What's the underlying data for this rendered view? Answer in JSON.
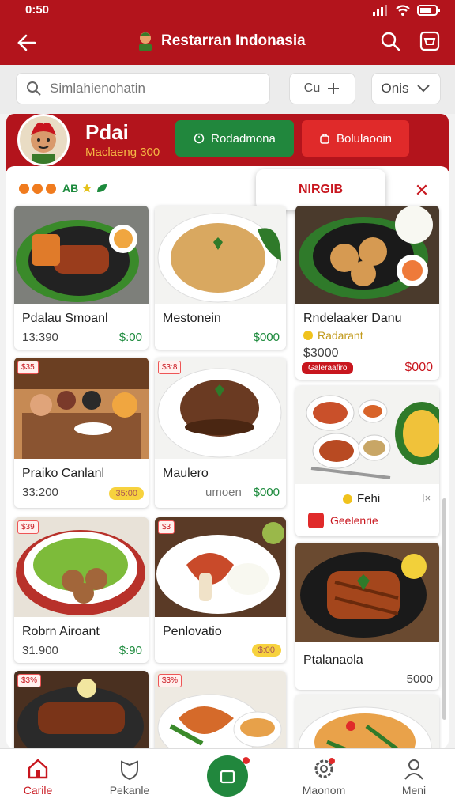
{
  "status": {
    "time": "0:50"
  },
  "appbar": {
    "title": "Restarran Indonasia"
  },
  "search": {
    "placeholder": "Simlahienohatin",
    "filter_label": "Cu",
    "sort_label": "Onis"
  },
  "profile": {
    "name": "Pdai",
    "subtitle": "Maclaeng 300",
    "btn_green": "Rodadmona",
    "btn_red": "Bolulaooin"
  },
  "panel": {
    "badge": "AB",
    "popup": "NIRGIB"
  },
  "cards": [
    {
      "name": "Pdalau Smoanl",
      "price": "13:390",
      "price2": "$:00"
    },
    {
      "name": "Mestonein",
      "price": "",
      "price2": "$000"
    },
    {
      "name": "Rndelaaker Danu",
      "sub": "Radarant",
      "price": "$3000",
      "tag2": "Galeraafiro",
      "price2": "$000"
    },
    {
      "name": "Praiko Canlanl",
      "price": "33:200",
      "pill": "35:00",
      "tag": "$35"
    },
    {
      "name": "Maulero",
      "price": "umoen",
      "price2": "$000",
      "tag": "$3:8"
    },
    {
      "name": "Fehi",
      "sub": "Geelenrie"
    },
    {
      "name": "Robrn Airoant",
      "price": "31.900",
      "price2": "$:90",
      "tag": "$39"
    },
    {
      "name": "Penlovatio",
      "pill": "$:00",
      "tag": "$3"
    },
    {
      "name": "Ptalanaola",
      "price2": "5000"
    },
    {
      "tag": "$3%"
    },
    {
      "tag": "$3%"
    }
  ],
  "nav": [
    {
      "label": "Carile"
    },
    {
      "label": "Pekanle"
    },
    {
      "label": "Maonom"
    },
    {
      "label": "Meni"
    }
  ],
  "colors": {
    "brand_red": "#b3141c",
    "green": "#21873d",
    "accent_red": "#e02a2a"
  }
}
